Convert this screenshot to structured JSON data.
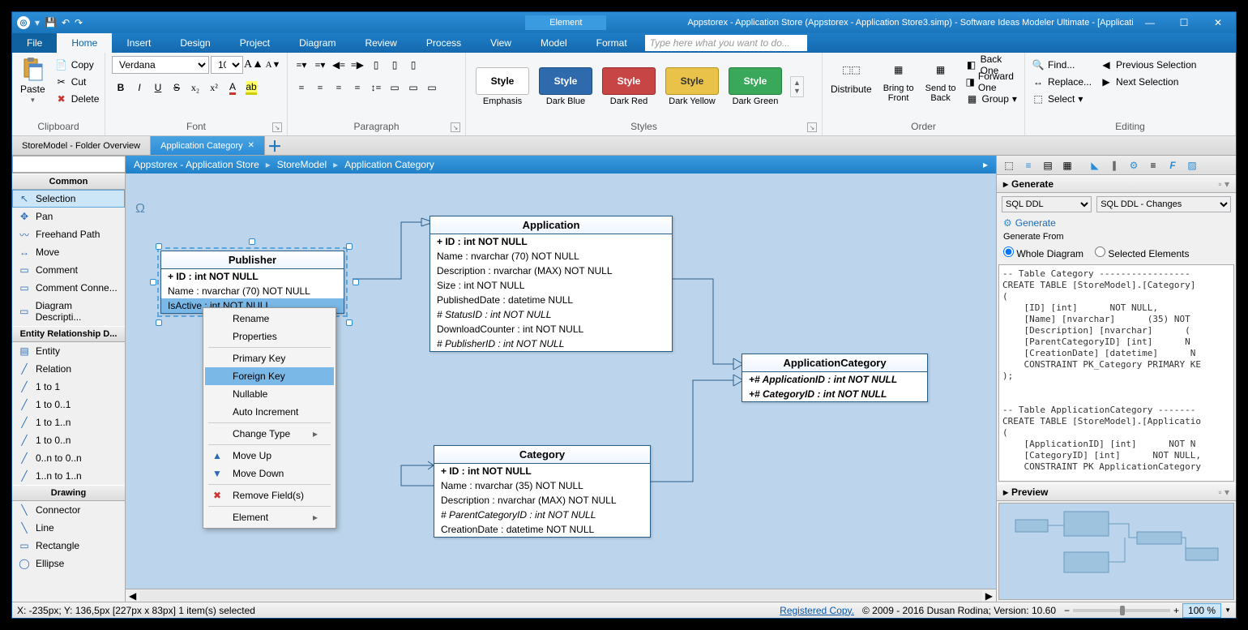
{
  "title": "Appstorex - Application Store (Appstorex - Application Store3.simp)  - Software Ideas Modeler Ultimate - [Application Category]",
  "tabContext": "Element",
  "menus": {
    "file": "File",
    "tabs": [
      "Home",
      "Insert",
      "Design",
      "Project",
      "Diagram",
      "Review",
      "Process",
      "View",
      "Model",
      "Format"
    ]
  },
  "searchPlaceholder": "Type here what you want to do...",
  "ribbon": {
    "clipboard": {
      "label": "Clipboard",
      "paste": "Paste",
      "copy": "Copy",
      "cut": "Cut",
      "delete": "Delete"
    },
    "font": {
      "label": "Font",
      "family": "Verdana",
      "size": "10"
    },
    "paragraph": {
      "label": "Paragraph"
    },
    "styles": {
      "label": "Styles",
      "items": [
        {
          "name": "Emphasis",
          "bg": "#fff",
          "fg": "#000",
          "border": "#bbb"
        },
        {
          "name": "Dark Blue",
          "bg": "#2f6aad",
          "fg": "#fff",
          "border": "#1d4d85"
        },
        {
          "name": "Dark Red",
          "bg": "#c84545",
          "fg": "#fff",
          "border": "#9a2b2b"
        },
        {
          "name": "Dark Yellow",
          "bg": "#e9c24a",
          "fg": "#333",
          "border": "#b8951f"
        },
        {
          "name": "Dark Green",
          "bg": "#3aa85a",
          "fg": "#fff",
          "border": "#22813d"
        }
      ]
    },
    "order": {
      "label": "Order",
      "distribute": "Distribute",
      "front": "Bring to\nFront",
      "back": "Send to\nBack",
      "backOne": "Back One",
      "forwardOne": "Forward One",
      "group": "Group"
    },
    "editing": {
      "label": "Editing",
      "find": "Find...",
      "replace": "Replace...",
      "select": "Select",
      "prevSel": "Previous Selection",
      "nextSel": "Next Selection"
    }
  },
  "docTabs": [
    {
      "label": "StoreModel - Folder Overview",
      "active": false
    },
    {
      "label": "Application Category",
      "active": true
    }
  ],
  "breadcrumb": [
    "Appstorex - Application Store",
    "StoreModel",
    "Application Category"
  ],
  "toolbox": {
    "common": {
      "label": "Common",
      "items": [
        "Selection",
        "Pan",
        "Freehand Path",
        "Move",
        "Comment",
        "Comment Conne...",
        "Diagram Descripti..."
      ]
    },
    "erd": {
      "label": "Entity Relationship D...",
      "items": [
        "Entity",
        "Relation",
        "1 to 1",
        "1 to 0..1",
        "1 to 1..n",
        "1 to 0..n",
        "0..n to 0..n",
        "1..n to 1..n"
      ]
    },
    "drawing": {
      "label": "Drawing",
      "items": [
        "Connector",
        "Line",
        "Rectangle",
        "Ellipse"
      ]
    }
  },
  "entities": {
    "publisher": {
      "title": "Publisher",
      "rows": [
        {
          "t": "+ ID : int NOT NULL",
          "pk": true
        },
        {
          "t": "Name : nvarchar (70)  NOT NULL"
        },
        {
          "t": "IsActive : int NOT NULL",
          "sel": true
        }
      ]
    },
    "application": {
      "title": "Application",
      "rows": [
        {
          "t": "+ ID : int NOT NULL",
          "pk": true
        },
        {
          "t": "Name : nvarchar (70)  NOT NULL"
        },
        {
          "t": "Description : nvarchar (MAX)  NOT NULL"
        },
        {
          "t": "Size : int NOT NULL"
        },
        {
          "t": "PublishedDate : datetime NULL"
        },
        {
          "t": "# StatusID : int NOT NULL",
          "fk": true
        },
        {
          "t": "DownloadCounter : int NOT NULL"
        },
        {
          "t": "# PublisherID : int NOT NULL",
          "fk": true
        }
      ]
    },
    "appcat": {
      "title": "ApplicationCategory",
      "rows": [
        {
          "t": "+# ApplicationID : int NOT NULL",
          "pk": true,
          "fk": true
        },
        {
          "t": "+# CategoryID : int NOT NULL",
          "pk": true,
          "fk": true
        }
      ]
    },
    "category": {
      "title": "Category",
      "rows": [
        {
          "t": "+ ID : int NOT NULL",
          "pk": true
        },
        {
          "t": "Name : nvarchar (35)  NOT NULL"
        },
        {
          "t": "Description : nvarchar (MAX)  NOT NULL"
        },
        {
          "t": "# ParentCategoryID : int NOT NULL",
          "fk": true
        },
        {
          "t": "CreationDate : datetime NOT NULL"
        }
      ]
    }
  },
  "floatbox": "1:1",
  "ctxmenu": [
    "Rename",
    "Properties",
    "-",
    "Primary Key",
    "Foreign Key",
    "Nullable",
    "Auto Increment",
    "-",
    "Change Type",
    "-",
    "Move Up",
    "Move Down",
    "-",
    "Remove Field(s)",
    "-",
    "Element"
  ],
  "ctxHighlight": "Foreign Key",
  "ctxSubmenu": [
    "Change Type",
    "Element"
  ],
  "rightPanel": {
    "generate": {
      "title": "Generate",
      "sel1": "SQL DDL",
      "sel2": "SQL DDL - Changes",
      "link": "Generate",
      "fromLabel": "Generate From",
      "r1": "Whole Diagram",
      "r2": "Selected Elements"
    },
    "code": "-- Table Category -----------------\nCREATE TABLE [StoreModel].[Category]\n(\n    [ID] [int]      NOT NULL,\n    [Name] [nvarchar]      (35) NOT \n    [Description] [nvarchar]      (\n    [ParentCategoryID] [int]      N\n    [CreationDate] [datetime]      N\n    CONSTRAINT PK_Category PRIMARY KE\n);\n\n\n-- Table ApplicationCategory -------\nCREATE TABLE [StoreModel].[Applicatio\n(\n    [ApplicationID] [int]      NOT N\n    [CategoryID] [int]      NOT NULL,\n    CONSTRAINT PK ApplicationCategory",
    "preview": "Preview"
  },
  "status": {
    "left": "X: -235px; Y: 136,5px  [227px x 83px] 1 item(s) selected",
    "link": "Registered Copy.",
    "copy": "© 2009 - 2016 Dusan Rodina; Version: 10.60",
    "zoom": "100 %"
  }
}
